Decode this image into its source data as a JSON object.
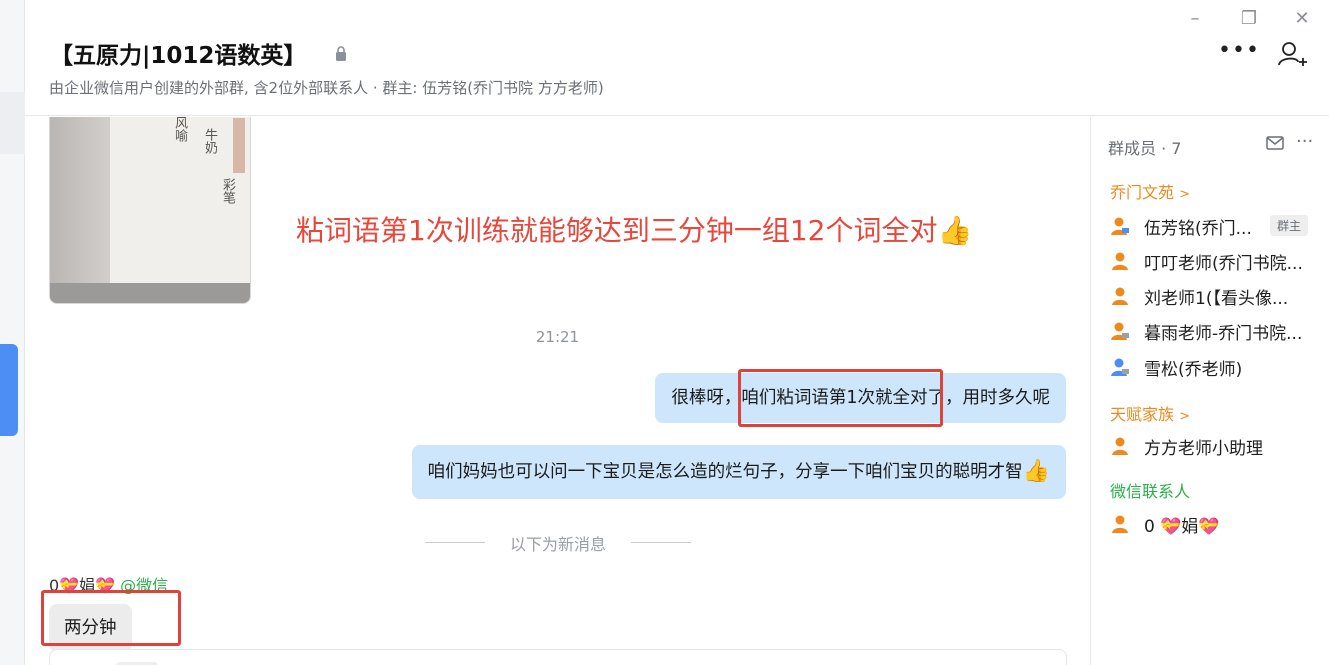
{
  "header": {
    "title": "【五原力|1012语数英】",
    "subtitle": "由企业微信用户创建的外部群, 含2位外部联系人 · 群主: 伍芳铭(乔门书院 方方老师)",
    "more_icon": "•••"
  },
  "window_controls": {
    "minimize": "–",
    "restore": "❐",
    "close": "✕"
  },
  "chat": {
    "banner_text": "粘词语第1次训练就能够达到三分钟一组12个词全对",
    "banner_emoji": "👍",
    "timestamp": "21:21",
    "outgoing": [
      {
        "text": "很棒呀，咱们粘词语第1次就全对了，用时多久呢",
        "emoji": ""
      },
      {
        "text": "咱们妈妈也可以问一下宝贝是怎么造的烂句子，分享一下咱们宝贝的聪明才智",
        "emoji": "👍"
      }
    ],
    "new_messages_divider": "以下为新消息",
    "incoming_sender": {
      "name_prefix": "0",
      "heart": "💝",
      "name_mid": "娟",
      "source": "@微信"
    },
    "incoming_message": "两分钟"
  },
  "members": {
    "title": "群成员 · 7",
    "sections": [
      {
        "label": "乔门文苑",
        "items": [
          {
            "name": "伍芳铭(乔门...",
            "badge": "群主",
            "color": "#ee8a1d"
          },
          {
            "name": "叮叮老师(乔门书院...",
            "badge": "",
            "color": "#ee8a1d"
          },
          {
            "name": "刘老师1(【看头像...",
            "badge": "",
            "color": "#ee8a1d"
          },
          {
            "name": "暮雨老师-乔门书院...",
            "badge": "",
            "color": "#ee8a1d"
          },
          {
            "name": "雪松(乔老师)",
            "badge": "",
            "color": "#4d8ef5"
          }
        ]
      },
      {
        "label": "天赋家族",
        "items": [
          {
            "name": "方方老师小助理",
            "badge": "",
            "color": "#ee8a1d"
          }
        ]
      },
      {
        "label": "微信联系人",
        "items": [
          {
            "name_prefix": "0",
            "heart": "💝",
            "name_mid": "娟",
            "color": "#ee8a1d"
          }
        ]
      }
    ]
  },
  "colors": {
    "accent_blue": "#4d8ef5",
    "bubble_out": "#cde6fb",
    "highlight_red": "#e0423a",
    "banner_red": "#e8473b",
    "wechat_green": "#2bb04a",
    "section_orange": "#ee8a1d"
  }
}
